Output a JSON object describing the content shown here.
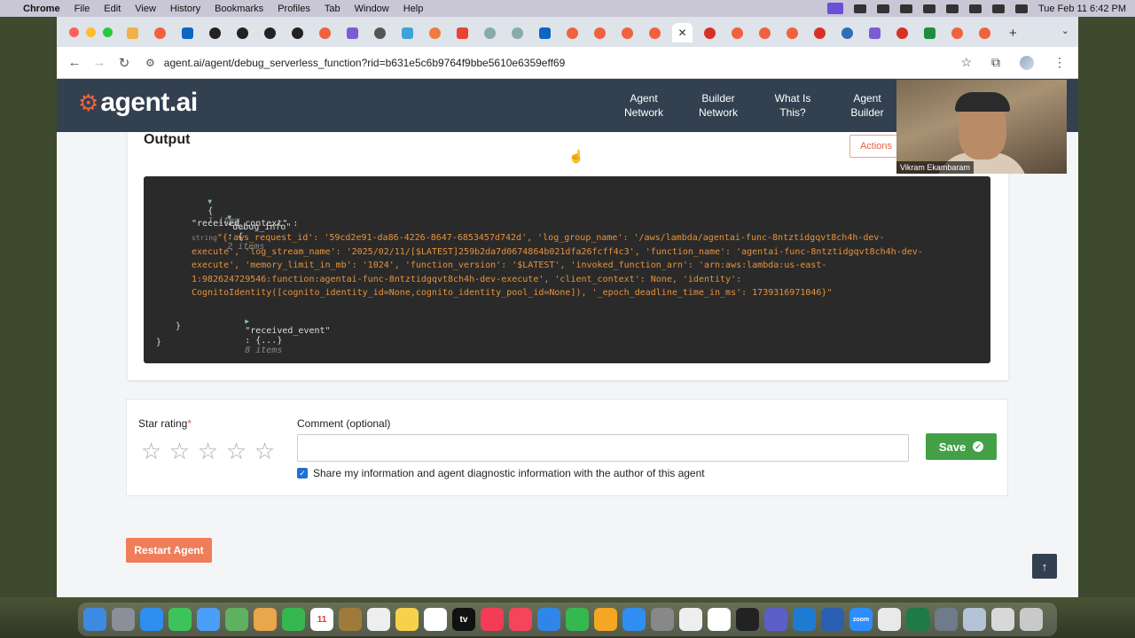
{
  "menubar": {
    "app_name": "Chrome",
    "items": [
      "File",
      "Edit",
      "View",
      "History",
      "Bookmarks",
      "Profiles",
      "Tab",
      "Window",
      "Help"
    ],
    "clock": "Tue Feb 11  6:42 PM"
  },
  "browser": {
    "tab_close_glyph": "✕",
    "new_tab_glyph": "+",
    "url": "agent.ai/agent/debug_serverless_function?rid=b631e5c6b9764f9bbe5610e6359eff69"
  },
  "site": {
    "logo_text": "agent.ai",
    "nav": [
      {
        "label": "Agent Network"
      },
      {
        "label": "Builder Network"
      },
      {
        "label": "What Is This?"
      },
      {
        "label": "Agent Builder"
      }
    ]
  },
  "output": {
    "title": "Output",
    "actions_label": "Actions",
    "json": {
      "root_open": "{",
      "root_count": "1 item",
      "debug_key": "\"debug_info\"",
      "colon_brace": ": {",
      "debug_count": "2 items",
      "received_context_key": "\"received_context\" :",
      "type_label": "string",
      "context_line1": "\"{'aws_request_id': '59cd2e91-da86-4226-8647-6853457d742d', 'log_group_name': '/aws/lambda/agentai-func-8ntztidgqvt8ch4h-dev-",
      "context_line2": "execute', 'log_stream_name': '2025/02/11/[$LATEST]259b2da7d0674864b021dfa26fcff4c3', 'function_name': 'agentai-func-8ntztidgqvt8ch4h-dev-",
      "context_line3": "execute', 'memory_limit_in_mb': '1024', 'function_version': '$LATEST', 'invoked_function_arn': 'arn:aws:lambda:us-east-",
      "context_line4": "1:982624729546:function:agentai-func-8ntztidgqvt8ch4h-dev-execute', 'client_context': None, 'identity':",
      "context_line5": "CognitoIdentity([cognito_identity_id=None,cognito_identity_pool_id=None]), '_epoch_deadline_time_in_ms': 1739316971046}\"",
      "received_event_key": "\"received_event\"",
      "received_event_collapsed": ": {...}",
      "received_event_count": "8 items",
      "inner_close": "}",
      "root_close": "}"
    }
  },
  "rating": {
    "star_label": "Star rating",
    "required_mark": "*",
    "star_glyph": "☆",
    "stars": 5,
    "comment_label": "Comment (optional)",
    "comment_value": "",
    "save_label": "Save",
    "share_label": "Share my information and agent diagnostic information with the author of this agent",
    "share_checked": true
  },
  "restart_label": "Restart Agent",
  "to_top_glyph": "↑",
  "webcam": {
    "name": "Vikram Ekambaram"
  },
  "dock": {
    "calendar_day": "11",
    "tv_label": "tv",
    "zoom_label": "zoom"
  },
  "colors": {
    "header_bg": "#32404f",
    "accent": "#f0623e",
    "save_green": "#43a047",
    "json_bg": "#2a2a2a",
    "json_string": "#e8923a"
  }
}
